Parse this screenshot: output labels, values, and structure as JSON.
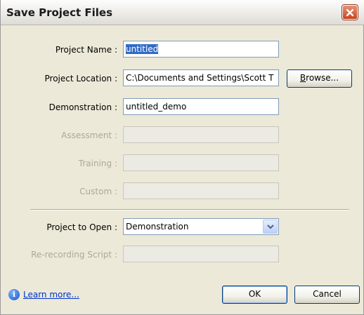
{
  "window": {
    "title": "Save Project Files"
  },
  "form": {
    "project_name": {
      "label": "Project Name :",
      "value": "untitled"
    },
    "project_location": {
      "label": "Project Location :",
      "value": "C:\\Documents and Settings\\Scott T"
    },
    "demonstration": {
      "label": "Demonstration :",
      "value": "untitled_demo"
    },
    "assessment": {
      "label": "Assessment :",
      "value": ""
    },
    "training": {
      "label": "Training :",
      "value": ""
    },
    "custom": {
      "label": "Custom :",
      "value": ""
    },
    "project_to_open": {
      "label": "Project to Open :",
      "selected": "Demonstration"
    },
    "rerecording_script": {
      "label": "Re-recording Script :",
      "value": ""
    }
  },
  "buttons": {
    "browse_prefix": "B",
    "browse_rest": "rowse...",
    "ok": "OK",
    "cancel": "Cancel"
  },
  "footer": {
    "info_glyph": "i",
    "learn_more": "Learn more..."
  },
  "colors": {
    "titlebar": "#f2f1ec",
    "dialog_bg": "#ece9d8",
    "close_button": "#d8623f",
    "selection": "#316ac5",
    "link": "#0033cc"
  },
  "icons": {
    "close": "close-x-icon",
    "dropdown": "chevron-down-icon",
    "info": "info-icon"
  }
}
